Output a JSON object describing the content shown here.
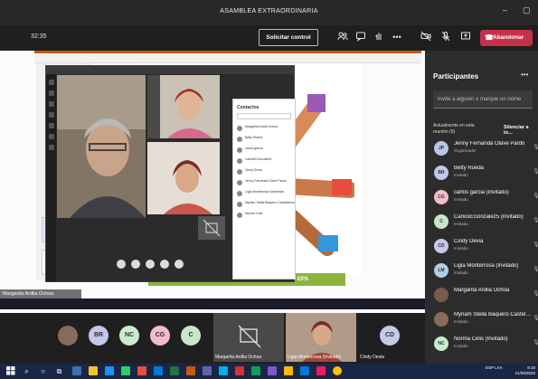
{
  "window": {
    "title": "ASAMBLEA EXTRAORDINARIA",
    "minimize": "–",
    "maximize": "▢"
  },
  "toolbar": {
    "timer": "32:35",
    "request_control": "Solicitar control",
    "leave": "Abandonar",
    "more": "•••"
  },
  "shared_screen": {
    "slide_caption": "ASOCIACIÓN DE USUARIOS ALIANSALUD EPS",
    "presenter_name": "Margarita Ardila Ochoa",
    "contacts_title": "Contactos",
    "contacts": [
      {
        "name": "Margarita Ardila Ochoa"
      },
      {
        "name": "Betty Rueda"
      },
      {
        "name": "carlos garcia"
      },
      {
        "name": "CarlosEGonzalez5"
      },
      {
        "name": "Cindy Devia"
      },
      {
        "name": "Jenny Fernanda Olave Pardo"
      },
      {
        "name": "Ligia Monterrosa Vanderlán"
      },
      {
        "name": "Myriam Stella Baquero Castellanos"
      },
      {
        "name": "Norma Celis"
      }
    ]
  },
  "panel": {
    "title": "Participantes",
    "invite_placeholder": "Invite a alguien o marque un núme",
    "section_label": "Actualmente en esta reunión (9)",
    "silence_all": "Silenciar a to...",
    "participants": [
      {
        "name": "Jenny Fernanda Olave Pardo",
        "role": "Organizador",
        "initials": "JP",
        "color": "#b7c7e8"
      },
      {
        "name": "Betty Rueda",
        "role": "Invitado",
        "initials": "BR",
        "color": "#c3c7ec"
      },
      {
        "name": "carlos garcia (Invitado)",
        "role": "Invitado",
        "initials": "CG",
        "color": "#f3bcc8"
      },
      {
        "name": "CarlosEGonzalez5 (Invitado)",
        "role": "Invitado",
        "initials": "C",
        "color": "#c8e6c9"
      },
      {
        "name": "Cindy Devia",
        "role": "Invitado",
        "initials": "CD",
        "color": "#c5cae9"
      },
      {
        "name": "Ligia Monterrosa (Invitado)",
        "role": "Invitado",
        "initials": "LM",
        "color": "#b3cde8"
      },
      {
        "name": "Margarita Ardila Ochoa",
        "role": "",
        "initials": "",
        "color": "#7a5a4a"
      },
      {
        "name": "Myriam Stella Baquero Castella...",
        "role": "Invitado",
        "initials": "",
        "color": "#8a6a5a"
      },
      {
        "name": "Norma Celis (Invitado)",
        "role": "Invitado",
        "initials": "NC",
        "color": "#c8ecd0"
      }
    ]
  },
  "strip": {
    "avatars": [
      {
        "initials": "",
        "color": "#8a6a5a"
      },
      {
        "initials": "BR",
        "color": "#c3c7ec"
      },
      {
        "initials": "NC",
        "color": "#c8ecd0"
      },
      {
        "initials": "CG",
        "color": "#f3bcc8"
      },
      {
        "initials": "C",
        "color": "#c8e6c9"
      }
    ],
    "tile_margarita": "Margarita Ardila Ochoa",
    "tile_ligia": "Ligia Monterrosa (Invitado)",
    "tile_cindy": "Cindy Devia",
    "cindy_initials": "CD"
  },
  "taskbar": {
    "lang": "ESP LAA",
    "time": "9:19",
    "date": "21/08/2020"
  }
}
